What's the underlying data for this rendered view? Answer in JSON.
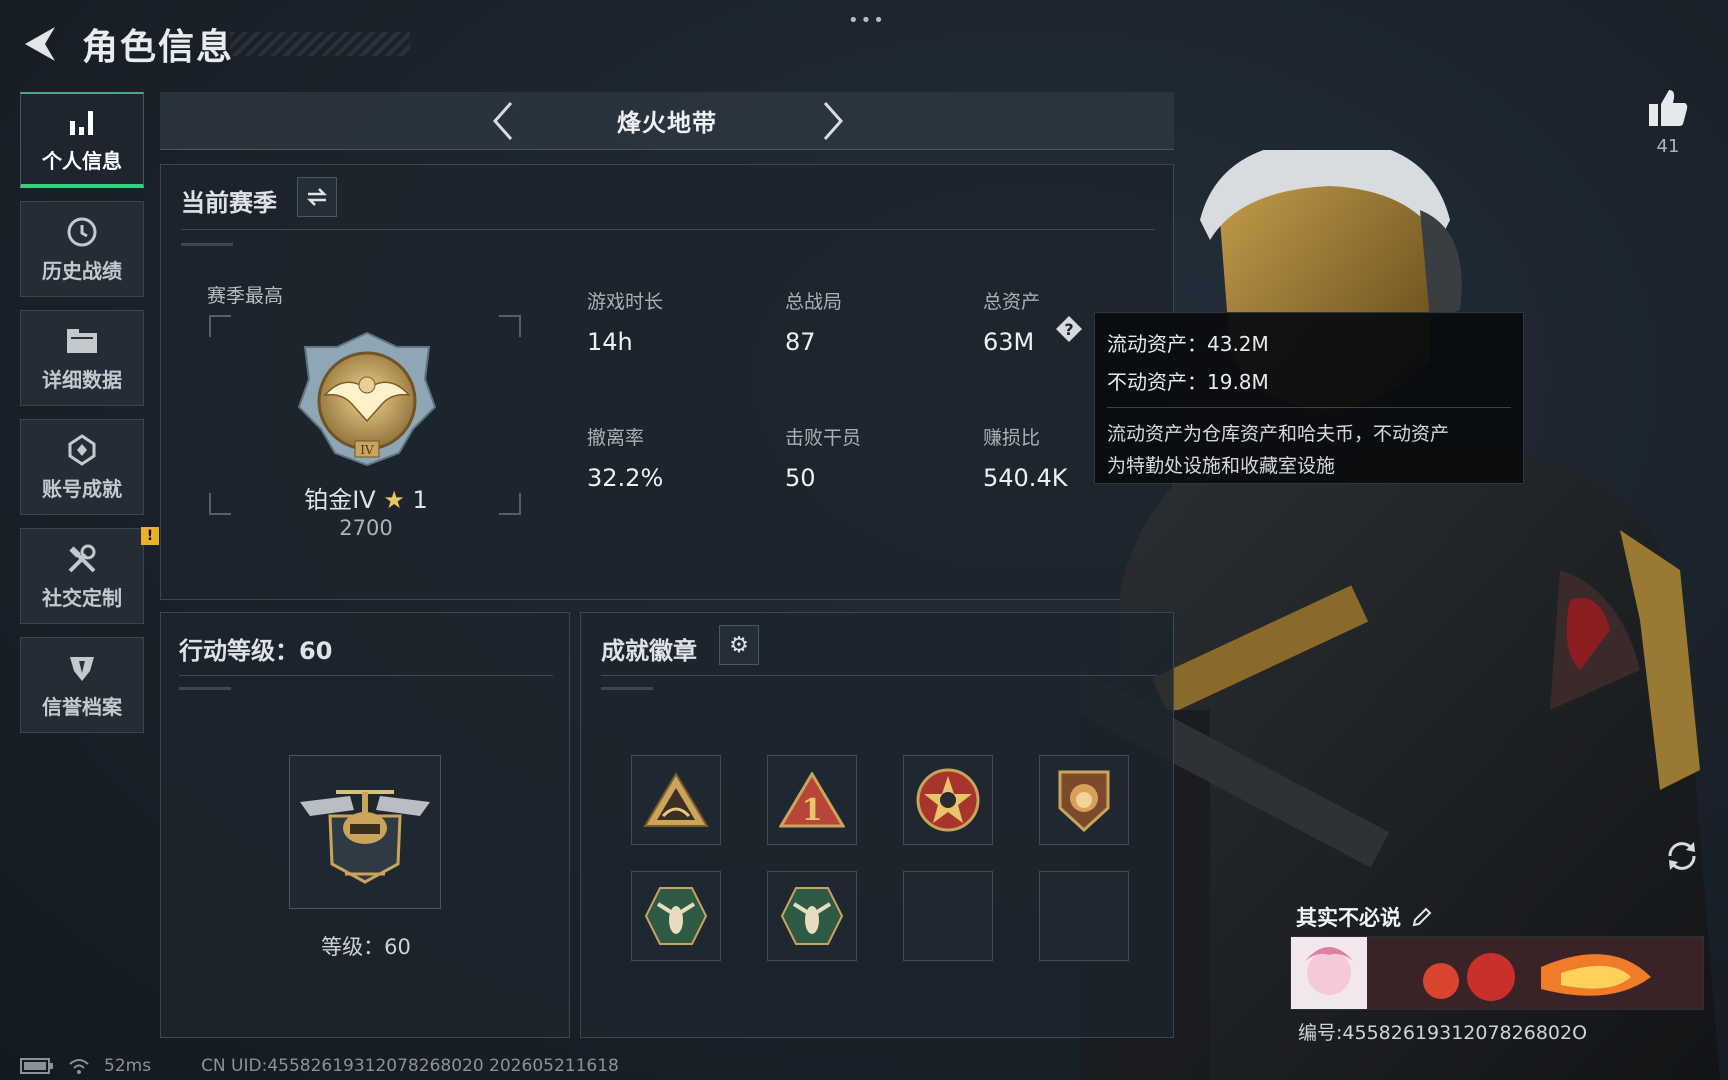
{
  "header": {
    "title": "角色信息",
    "more_dots": "•••"
  },
  "sidebar": {
    "items": [
      {
        "label": "个人信息",
        "icon": "bar-chart-icon",
        "active": true
      },
      {
        "label": "历史战绩",
        "icon": "history-clock-icon",
        "active": false
      },
      {
        "label": "详细数据",
        "icon": "folder-icon",
        "active": false
      },
      {
        "label": "账号成就",
        "icon": "achievement-icon",
        "active": false
      },
      {
        "label": "社交定制",
        "icon": "tools-icon",
        "active": false,
        "alert": "!"
      },
      {
        "label": "信誉档案",
        "icon": "credit-shield-icon",
        "active": false
      }
    ]
  },
  "mode": {
    "title": "烽火地带"
  },
  "season": {
    "title": "当前赛季",
    "subtitle": "赛季最高",
    "rank": {
      "name": "铂金IV",
      "stars": "1",
      "score": "2700"
    },
    "stats": [
      {
        "label": "游戏时长",
        "value": "14h"
      },
      {
        "label": "总战局",
        "value": "87"
      },
      {
        "label": "总资产",
        "value": "63M"
      },
      {
        "label": "撤离率",
        "value": "32.2%"
      },
      {
        "label": "击败干员",
        "value": "50"
      },
      {
        "label": "赚损比",
        "value": "540.4K"
      }
    ]
  },
  "tooltip": {
    "liquid": "流动资产：43.2M",
    "fixed": "不动资产：19.8M",
    "desc_line1": "流动资产为仓库资产和哈夫币，不动资产",
    "desc_line2": "为特勤处设施和收藏室设施"
  },
  "level": {
    "title": "行动等级：60",
    "text": "等级：60"
  },
  "badges": {
    "title": "成就徽章",
    "items": [
      "tent-badge-icon",
      "number-one-badge-icon",
      "star-badge-icon",
      "lion-badge-icon",
      "wasp-badge-icon",
      "wasp-badge-icon",
      "",
      ""
    ]
  },
  "character": {
    "likes": "41",
    "card_name": "其实不必说",
    "card_id": "编号:4558261931207826802O"
  },
  "footer": {
    "ping": "52ms",
    "uid": "CN UID:45582619312078268020 202605211618"
  },
  "colors": {
    "accent_green": "#34d27a",
    "alert_yellow": "#e9b12c",
    "gold": "#c9a45a"
  }
}
